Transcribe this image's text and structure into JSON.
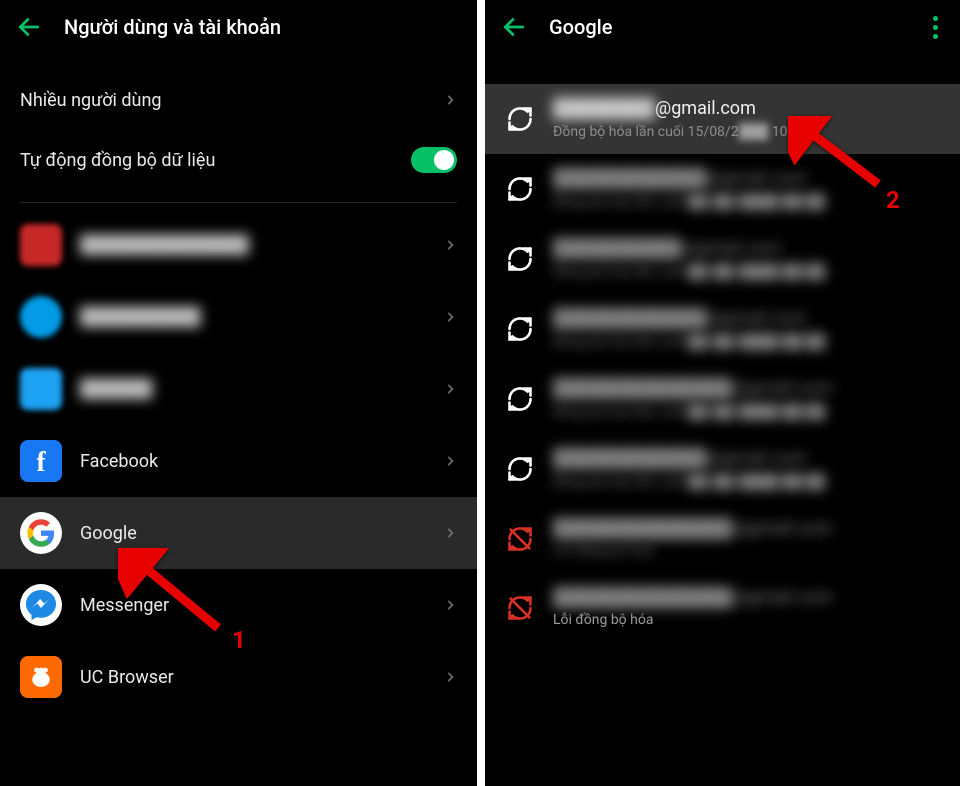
{
  "left": {
    "title": "Người dùng và tài khoản",
    "multi_users": "Nhiều người dùng",
    "auto_sync": "Tự động đồng bộ dữ liệu",
    "accounts": {
      "facebook": "Facebook",
      "google": "Google",
      "messenger": "Messenger",
      "uc_browser": "UC Browser"
    }
  },
  "right": {
    "title": "Google",
    "first": {
      "email_suffix": "@gmail.com",
      "sub_prefix": "Đồng bộ hóa lần cuối 15/08/2",
      "sub_suffix": "10:31"
    },
    "sync_error": "Lỗi đồng bộ hóa"
  },
  "annotations": {
    "one": "1",
    "two": "2"
  },
  "colors": {
    "accent": "#06c167",
    "arrow": "#e60000"
  }
}
